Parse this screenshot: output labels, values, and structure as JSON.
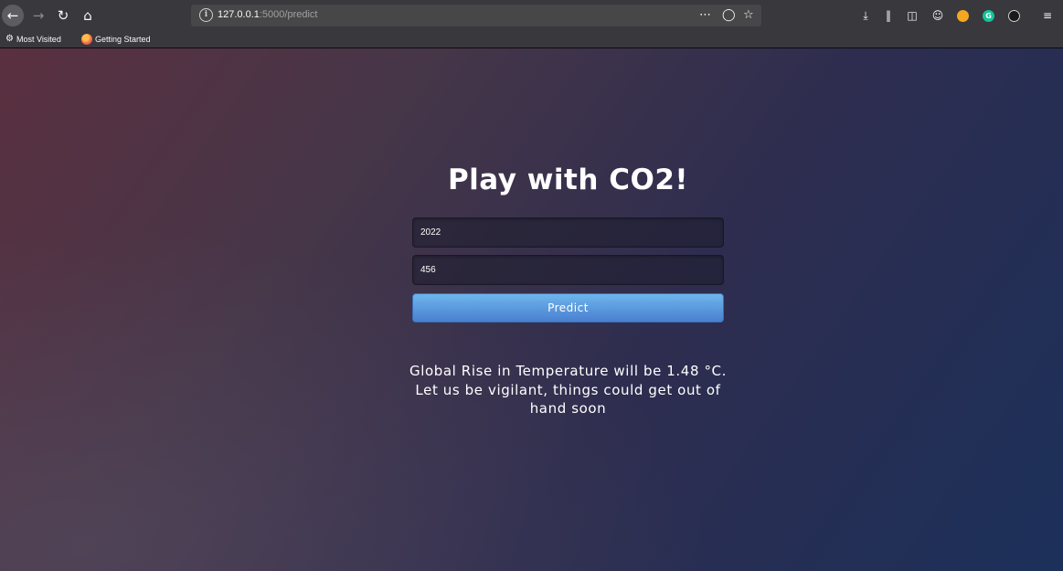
{
  "browser": {
    "url_host": "127.0.0.1",
    "url_path": ":5000/predict",
    "bookmarks": [
      {
        "label": "Most Visited"
      },
      {
        "label": "Getting Started"
      }
    ],
    "extension_letters": {
      "grammarly": "G"
    }
  },
  "page": {
    "title": "Play with CO2!",
    "year_value": "2022",
    "co2_value": "456",
    "predict_label": "Predict",
    "result": "Global Rise in Temperature will be 1.48 °C. Let us be vigilant, things could get out of hand soon"
  },
  "colors": {
    "button_top": "#6eb6ec",
    "button_bottom": "#4a7fd0",
    "chrome": "#38383d"
  }
}
